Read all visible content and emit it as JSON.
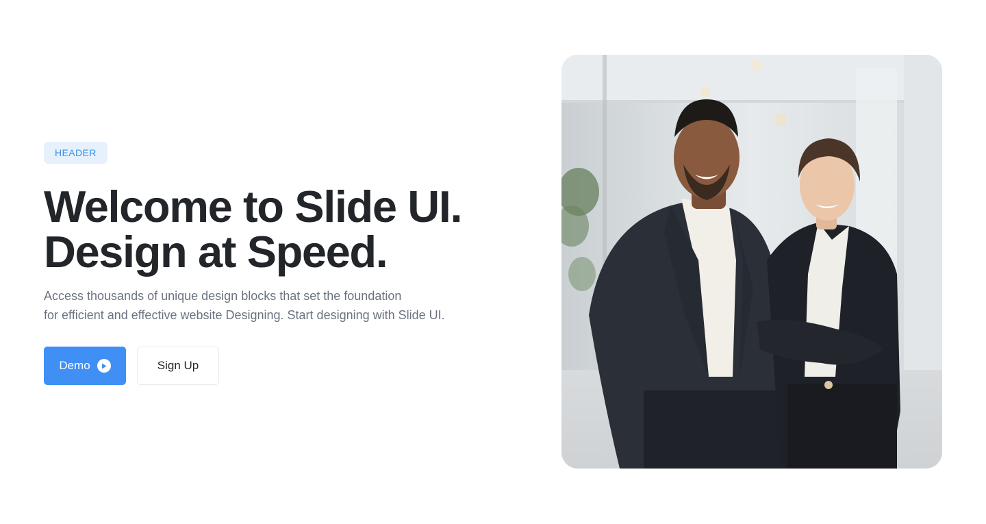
{
  "hero": {
    "badge": "HEADER",
    "title_line_1": "Welcome to Slide UI.",
    "title_line_2": "Design at Speed.",
    "description_line_1": "Access thousands of unique design blocks that set the foundation",
    "description_line_2": "for efficient and effective website Designing. Start designing with Slide UI.",
    "primary_button": {
      "label": "Demo",
      "icon": "play-circle-icon"
    },
    "secondary_button": {
      "label": "Sign Up"
    }
  },
  "colors": {
    "accent": "#3f8ff5",
    "badge_background": "#e6f1fd",
    "badge_text": "#3b8fe6",
    "heading": "#22262b",
    "body_text": "#6b7280"
  }
}
